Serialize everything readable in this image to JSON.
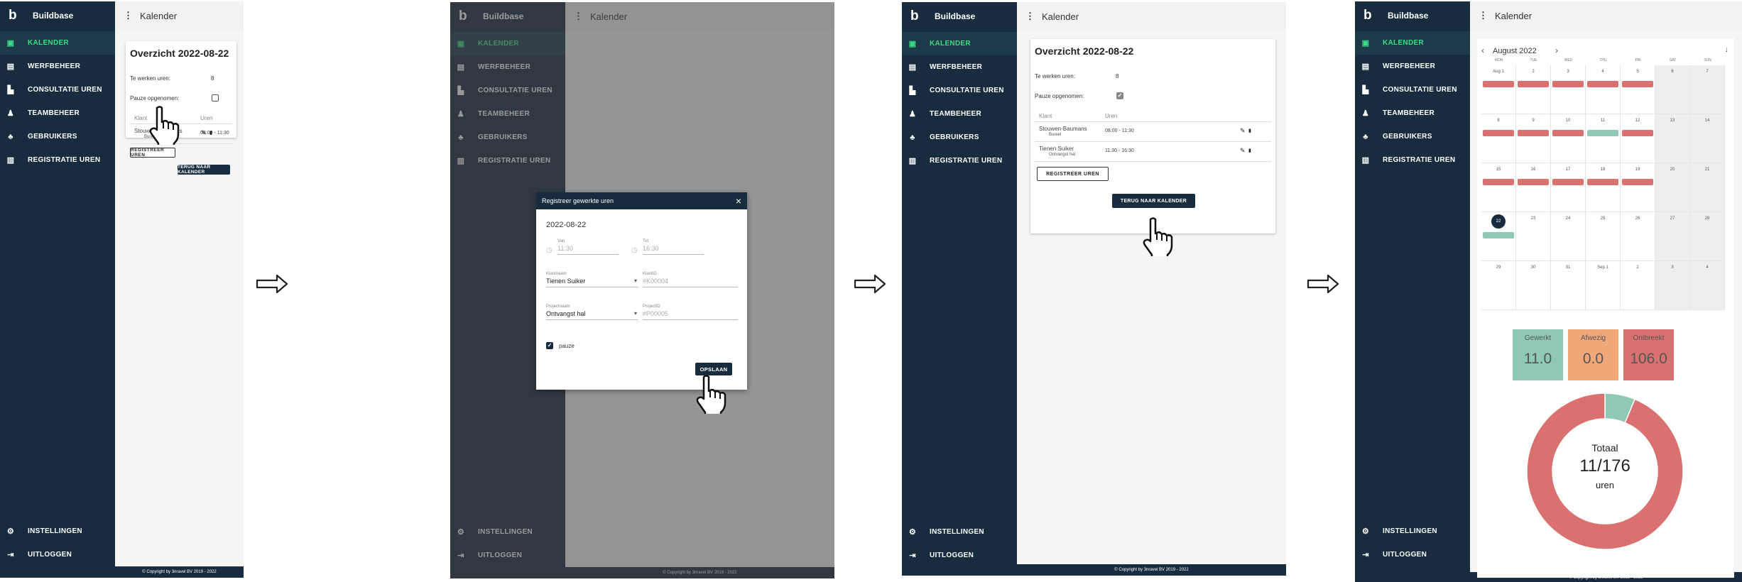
{
  "app": {
    "brand_logo": "b",
    "brand_name": "Buildbase",
    "page_title": "Kalender",
    "footer": "© Copyright by 3nravel BV 2019 - 2022"
  },
  "nav": [
    {
      "label": "KALENDER",
      "icon": "calendar-icon"
    },
    {
      "label": "WERFBEHEER",
      "icon": "id-card-icon"
    },
    {
      "label": "CONSULTATIE UREN",
      "icon": "document-icon"
    },
    {
      "label": "TEAMBEHEER",
      "icon": "team-icon"
    },
    {
      "label": "GEBRUIKERS",
      "icon": "users-icon"
    },
    {
      "label": "REGISTRATIE UREN",
      "icon": "book-icon"
    }
  ],
  "nav_bottom": [
    {
      "label": "INSTELLINGEN",
      "icon": "gear-icon"
    },
    {
      "label": "UITLOGGEN",
      "icon": "logout-icon"
    }
  ],
  "overview": {
    "title": "Overzicht 2022-08-22",
    "hours_label": "Te werken uren:",
    "hours_value": "8",
    "pause_label": "Pauze opgenomen:",
    "col_client": "Klant",
    "col_hours": "Uren",
    "rows": [
      {
        "client": "Stouwen-Baumans",
        "sub": "Bureel",
        "hours": "08:00 - 11:30"
      },
      {
        "client": "Tienen Suiker",
        "sub": "Ontvangst hal",
        "hours": "11:30 - 16:30"
      }
    ],
    "register_btn": "REGISTREER UREN",
    "back_btn": "TERUG NAAR KALENDER"
  },
  "dialog": {
    "title": "Registreer gewerkte uren",
    "close": "×",
    "date": "2022-08-22",
    "van_label": "Van",
    "van_value": "11:30",
    "tot_label": "Tot",
    "tot_value": "16:30",
    "klantnaam_label": "Klantnaam",
    "klantnaam_value": "Tienen Suiker",
    "klantid_label": "KlantID",
    "klantid_value": "#K00004",
    "projectnaam_label": "Projectnaam",
    "projectnaam_value": "Ontvangst hal",
    "projectid_label": "ProjectID",
    "projectid_value": "#P00005",
    "pause_label": "pauze",
    "save_btn": "OPSLAAN"
  },
  "calendar": {
    "month": "August 2022",
    "prev": "‹",
    "next": "›",
    "download": "↓",
    "weekdays": [
      "MON",
      "TUE",
      "WED",
      "THU",
      "FRI",
      "SAT",
      "SUN"
    ],
    "weeks": [
      [
        "Aug 1",
        "2",
        "3",
        "4",
        "5",
        "6",
        "7"
      ],
      [
        "8",
        "9",
        "10",
        "11",
        "12",
        "13",
        "14"
      ],
      [
        "15",
        "16",
        "17",
        "18",
        "19",
        "20",
        "21"
      ],
      [
        "22",
        "23",
        "24",
        "25",
        "26",
        "27",
        "28"
      ],
      [
        "29",
        "30",
        "31",
        "Sep 1",
        "2",
        "3",
        "4"
      ]
    ],
    "today": "22",
    "colors": {
      "ontbreekt": "#d9716f",
      "gewerkt": "#8fc9b3",
      "afwezig": "#f0a87a"
    }
  },
  "stats": [
    {
      "label": "Gewerkt",
      "value": "11.0",
      "color": "#8fc9b3"
    },
    {
      "label": "Afwezig",
      "value": "0.0",
      "color": "#f0a87a"
    },
    {
      "label": "Ontbreekt",
      "value": "106.0",
      "color": "#d9716f"
    }
  ],
  "donut": {
    "total_label": "Totaal",
    "total_value": "11/176",
    "unit": "uren",
    "worked": 11,
    "total": 176
  },
  "arrow_glyph": "⇒"
}
